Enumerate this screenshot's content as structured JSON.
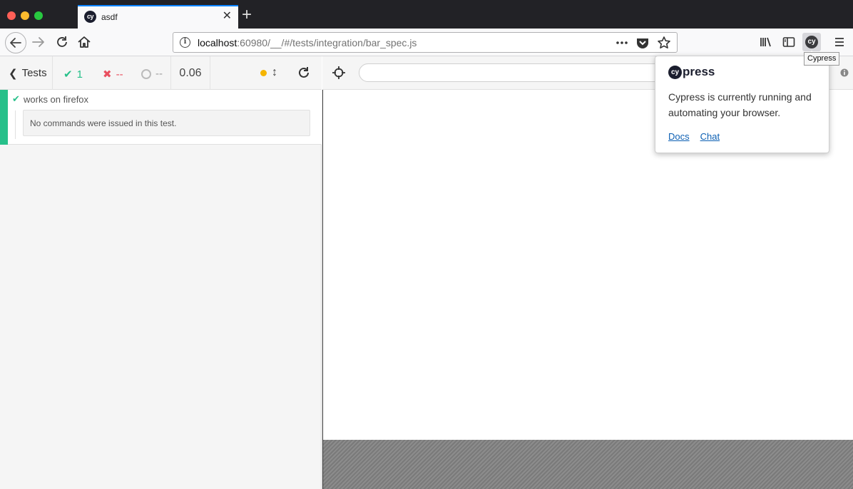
{
  "browser": {
    "tab": {
      "title": "asdf",
      "favicon": "cy"
    },
    "address": {
      "host": "localhost",
      "path": ":60980/__/#/tests/integration/bar_spec.js"
    },
    "extension_tooltip": "Cypress",
    "accent_color": "#0a84ff"
  },
  "reporter": {
    "back_label": "Tests",
    "stats": {
      "passed": "1",
      "failed": "--",
      "pending": "--"
    },
    "duration": "0.06",
    "colors": {
      "passed": "#27c08a",
      "failed": "#e94f5f",
      "running": "#f5b500"
    },
    "tests": [
      {
        "title": "works on firefox",
        "state": "passed",
        "message": "No commands were issued in this test."
      }
    ]
  },
  "popup": {
    "logo_prefix": "cy",
    "logo_text": "press",
    "message": "Cypress is currently running and automating your browser.",
    "links": [
      "Docs",
      "Chat"
    ]
  },
  "icons": [
    "back-arrow-icon",
    "forward-arrow-icon",
    "reload-icon",
    "home-icon",
    "info-icon",
    "more-icon",
    "pocket-icon",
    "star-icon",
    "library-icon",
    "sidebar-icon",
    "cypress-icon",
    "menu-icon",
    "crosshair-icon",
    "restart-icon"
  ]
}
